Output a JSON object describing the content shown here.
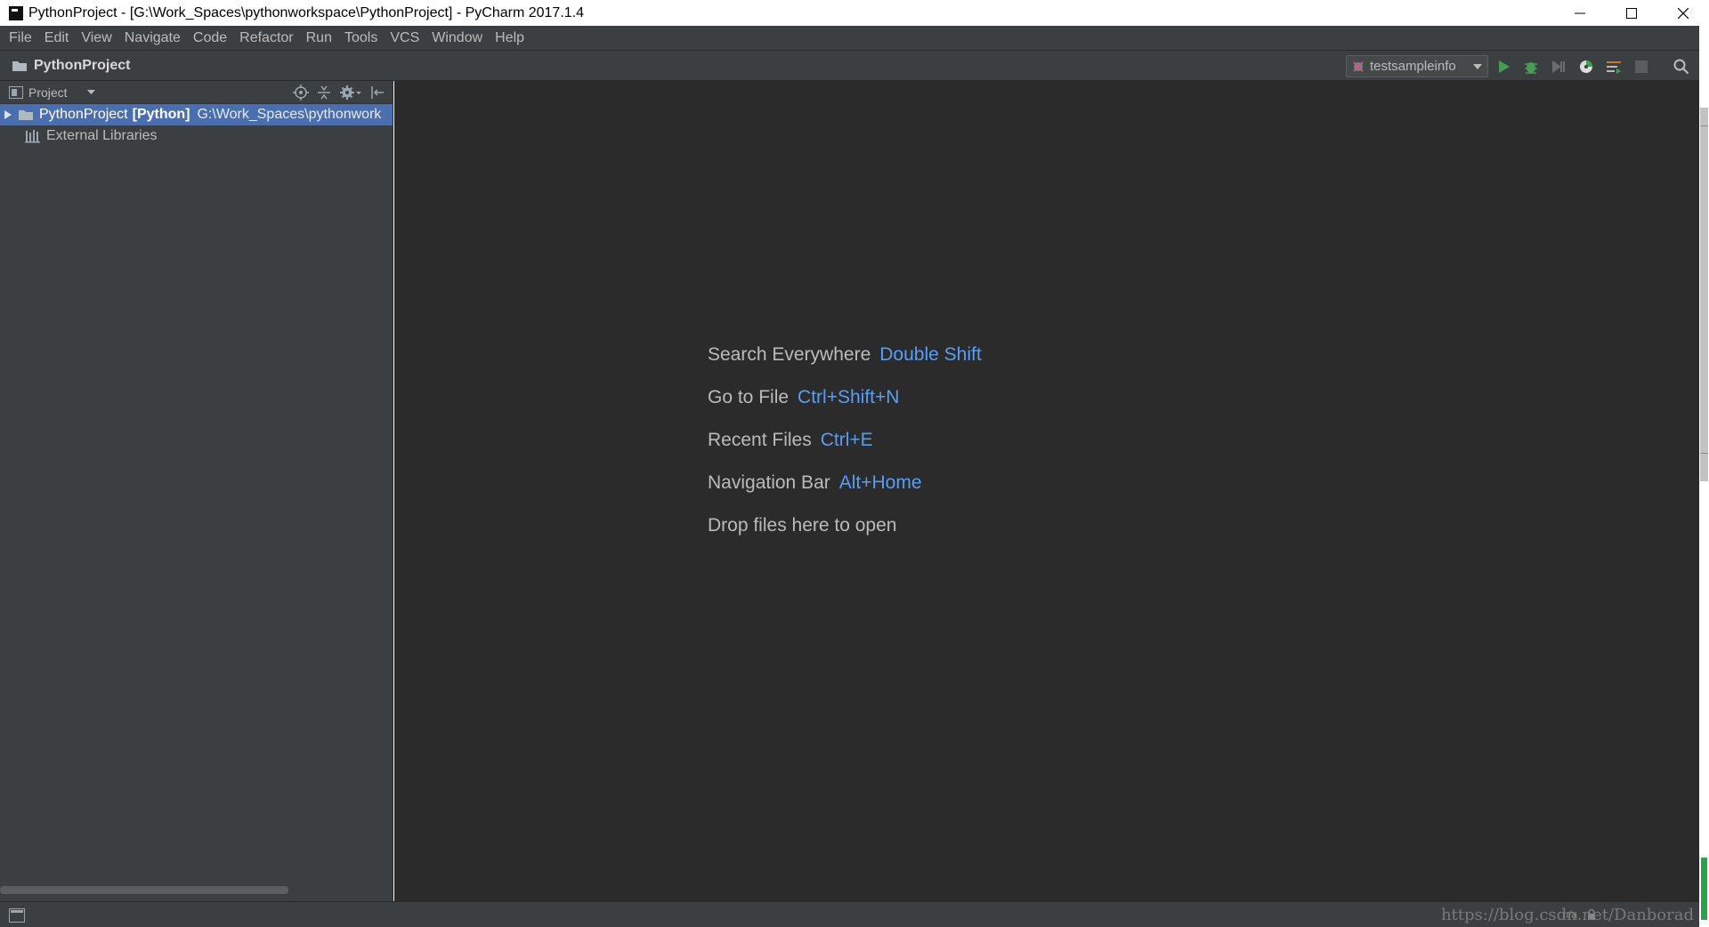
{
  "window": {
    "title": "PythonProject - [G:\\Work_Spaces\\pythonworkspace\\PythonProject] - PyCharm 2017.1.4"
  },
  "menu": {
    "items": [
      "File",
      "Edit",
      "View",
      "Navigate",
      "Code",
      "Refactor",
      "Run",
      "Tools",
      "VCS",
      "Window",
      "Help"
    ]
  },
  "navbar": {
    "breadcrumb": "PythonProject",
    "run_config": "testsampleinfo"
  },
  "project_panel": {
    "title": "Project",
    "tree": [
      {
        "name": "PythonProject",
        "tag": "[Python]",
        "path": "G:\\Work_Spaces\\pythonwork"
      },
      {
        "name": "External Libraries"
      }
    ]
  },
  "editor": {
    "hints": [
      {
        "label": "Search Everywhere",
        "key": "Double Shift"
      },
      {
        "label": "Go to File",
        "key": "Ctrl+Shift+N"
      },
      {
        "label": "Recent Files",
        "key": "Ctrl+E"
      },
      {
        "label": "Navigation Bar",
        "key": "Alt+Home"
      },
      {
        "label": "Drop files here to open",
        "key": ""
      }
    ]
  },
  "statusbar": {
    "position": "n/a",
    "watermark": "https://blog.csdn.net/Danborad"
  },
  "colors": {
    "accent_blue": "#589df6",
    "selection": "#4b6eaf",
    "panel_bg": "#3c3f41",
    "editor_bg": "#2b2b2b",
    "run_green": "#499c54"
  },
  "icons": {
    "app": "pycharm-icon",
    "folder": "folder-icon",
    "libraries": "libraries-icon",
    "run": "run-icon",
    "debug": "debug-icon",
    "coverage": "coverage-icon",
    "profile": "profile-icon",
    "concurrency": "concurrency-icon",
    "stop": "stop-icon",
    "search": "search-icon"
  }
}
